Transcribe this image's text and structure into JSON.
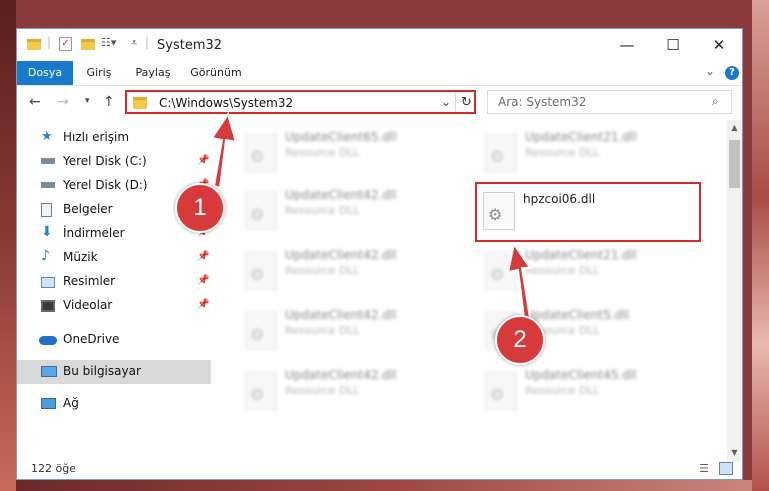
{
  "window": {
    "title": "System32",
    "controls": {
      "minimize": "—",
      "maximize": "☐",
      "close": "✕"
    }
  },
  "ribbon": {
    "tabs": [
      "Dosya",
      "Giriş",
      "Paylaş",
      "Görünüm"
    ],
    "help": "?",
    "collapse": "⌄"
  },
  "address": {
    "path": "C:\\Windows\\System32",
    "refresh": "↻",
    "dropdown": "⌄",
    "search_placeholder": "Ara: System32"
  },
  "nav": {
    "items": [
      {
        "label": "Hızlı erişim",
        "icon": "star-icon"
      },
      {
        "label": "Yerel Disk (C:)",
        "icon": "drive-icon",
        "pinned": true
      },
      {
        "label": "Yerel Disk (D:)",
        "icon": "drive-icon",
        "pinned": true
      },
      {
        "label": "Belgeler",
        "icon": "document-icon",
        "pinned": true
      },
      {
        "label": "İndirmeler",
        "icon": "download-icon",
        "pinned": true
      },
      {
        "label": "Müzik",
        "icon": "music-icon",
        "pinned": true
      },
      {
        "label": "Resimler",
        "icon": "pictures-icon",
        "pinned": true
      },
      {
        "label": "Videolar",
        "icon": "video-icon",
        "pinned": true
      },
      {
        "label": "OneDrive",
        "icon": "cloud-icon"
      },
      {
        "label": "Bu bilgisayar",
        "icon": "computer-icon",
        "selected": true
      },
      {
        "label": "Ağ",
        "icon": "network-icon"
      }
    ]
  },
  "files": {
    "left": [
      {
        "name": "UpdateClient65.dll",
        "type": "Resource DLL"
      },
      {
        "name": "UpdateClient42.dll",
        "type": "Resource DLL"
      },
      {
        "name": "UpdateClient42.dll",
        "type": "Resource DLL"
      },
      {
        "name": "UpdateClient42.dll",
        "type": "Resource DLL"
      },
      {
        "name": "UpdateClient42.dll",
        "type": "Resource DLL"
      }
    ],
    "right": [
      {
        "name": "UpdateClient21.dll",
        "type": "Resource DLL"
      },
      {
        "name": "hpzcoi06.dll",
        "type": ""
      },
      {
        "name": "UpdateClient21.dll",
        "type": "Resource DLL"
      },
      {
        "name": "UpdateClient5.dll",
        "type": "Resource DLL"
      },
      {
        "name": "UpdateClient45.dll",
        "type": "Resource DLL"
      }
    ]
  },
  "status": {
    "count": "122 öğe"
  },
  "annotations": {
    "step1": "1",
    "step2": "2"
  },
  "colors": {
    "accent": "#1979ca",
    "highlight": "#d22b2b",
    "badge": "#d63a3a"
  }
}
